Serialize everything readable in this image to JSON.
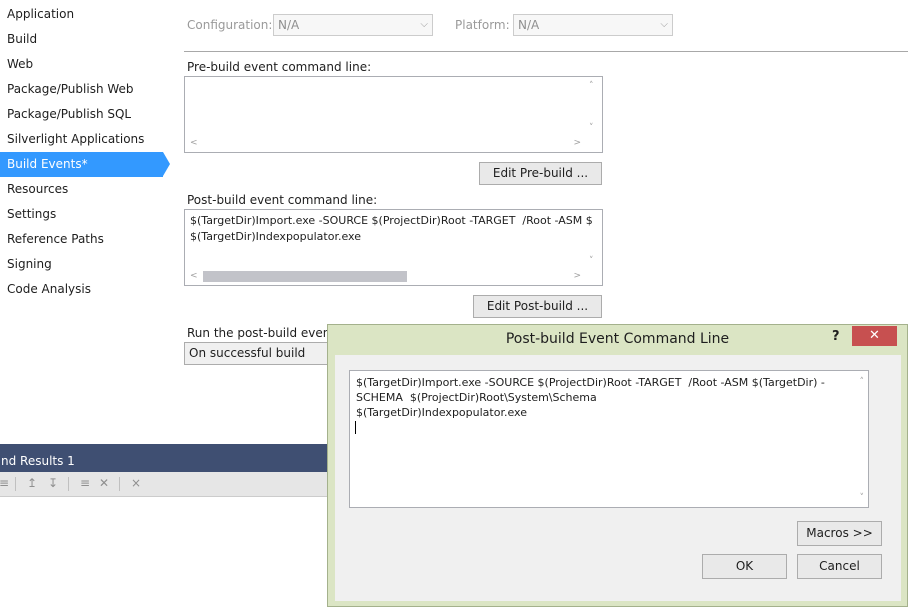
{
  "sidebar": {
    "items": [
      {
        "label": "Application"
      },
      {
        "label": "Build"
      },
      {
        "label": "Web"
      },
      {
        "label": "Package/Publish Web"
      },
      {
        "label": "Package/Publish SQL"
      },
      {
        "label": "Silverlight Applications"
      },
      {
        "label": "Build Events*"
      },
      {
        "label": "Resources"
      },
      {
        "label": "Settings"
      },
      {
        "label": "Reference Paths"
      },
      {
        "label": "Signing"
      },
      {
        "label": "Code Analysis"
      }
    ],
    "selected": "Build Events*",
    "accent": "#3399ff"
  },
  "config_bar": {
    "configuration_label": "Configuration:",
    "configuration_value": "N/A",
    "platform_label": "Platform:",
    "platform_value": "N/A"
  },
  "prebuild": {
    "label": "Pre-build event command line:",
    "value": "",
    "edit_button": "Edit Pre-build ..."
  },
  "postbuild": {
    "label": "Post-build event command line:",
    "line1": "$(TargetDir)Import.exe -SOURCE $(ProjectDir)Root -TARGET  /Root -ASM $",
    "line2": "$(TargetDir)Indexpopulator.exe",
    "edit_button": "Edit Post-build ..."
  },
  "run_postbuild": {
    "label": "Run the post-build event:",
    "value": "On successful build"
  },
  "results_window": {
    "title": "nd Results 1"
  },
  "dialog": {
    "title": "Post-build Event Command Line",
    "help": "?",
    "close": "✕",
    "line1": "$(TargetDir)Import.exe -SOURCE $(ProjectDir)Root -TARGET  /Root -ASM $(TargetDir) -",
    "line2": "SCHEMA  $(ProjectDir)Root\\System\\Schema",
    "line3": "$(TargetDir)Indexpopulator.exe",
    "macros_button": "Macros >>",
    "ok_button": "OK",
    "cancel_button": "Cancel",
    "titlebar_color": "#dbe5c4",
    "close_color": "#c75050"
  }
}
